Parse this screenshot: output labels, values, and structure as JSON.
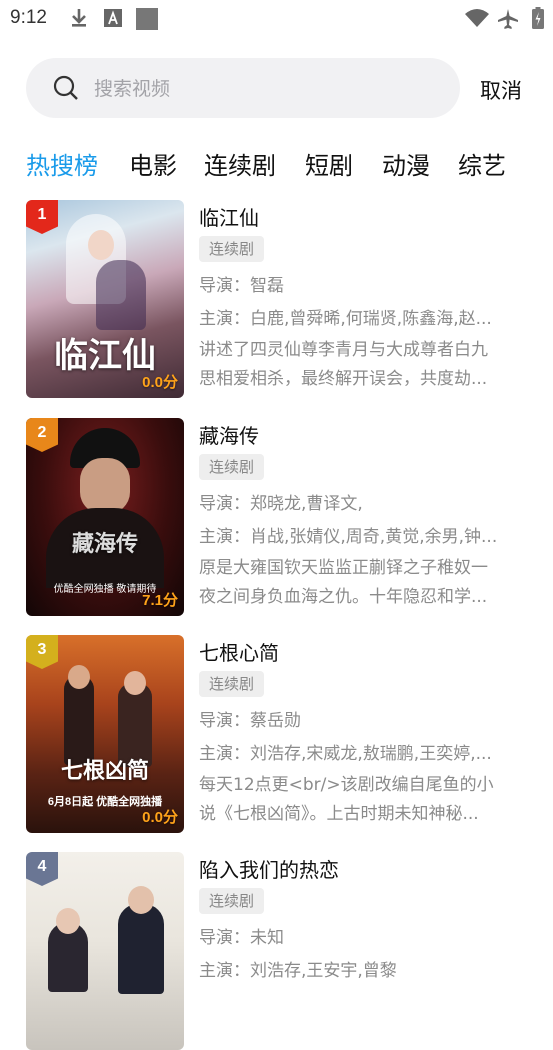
{
  "status_bar": {
    "time": "9:12",
    "left_icons": [
      "download-icon",
      "a-box-icon",
      "square-icon"
    ],
    "right_icons": [
      "wifi-icon",
      "airplane-icon",
      "battery-icon"
    ]
  },
  "search": {
    "placeholder": "搜索视频",
    "value": "",
    "cancel_label": "取消"
  },
  "tabs": [
    {
      "label": "热搜榜",
      "active": true
    },
    {
      "label": "电影",
      "active": false
    },
    {
      "label": "连续剧",
      "active": false
    },
    {
      "label": "短剧",
      "active": false
    },
    {
      "label": "动漫",
      "active": false
    },
    {
      "label": "综艺",
      "active": false
    }
  ],
  "colors": {
    "accent": "#1a9bea",
    "score": "#ffa31a",
    "rank_1": "#e3281b",
    "rank_2": "#e8871a",
    "rank_3": "#d4b01d",
    "rank_other": "#6a7694"
  },
  "items": [
    {
      "rank": "1",
      "title": "临江仙",
      "tag": "连续剧",
      "director": "导演：智磊",
      "cast": "主演：白鹿,曾舜晞,何瑞贤,陈鑫海,赵...",
      "desc1": "讲述了四灵仙尊李青月与大成尊者白九",
      "desc2": "思相爱相杀，最终解开误会，共度劫...",
      "score": "0.0分",
      "poster_text": "临江仙"
    },
    {
      "rank": "2",
      "title": "藏海传",
      "tag": "连续剧",
      "director": "导演：郑晓龙,曹译文,",
      "cast": "主演：肖战,张婧仪,周奇,黄觉,余男,钟...",
      "desc1": "原是大雍国钦天监监正蒯铎之子稚奴一",
      "desc2": "夜之间身负血海之仇。十年隐忍和学...",
      "score": "7.1分",
      "poster_text": "藏海传",
      "poster_note": "优酷全网独播 敬请期待"
    },
    {
      "rank": "3",
      "title": "七根心简",
      "tag": "连续剧",
      "director": "导演：蔡岳勋",
      "cast": "主演：刘浩存,宋威龙,敖瑞鹏,王奕婷,...",
      "desc1": "每天12点更<br/>该剧改编自尾鱼的小",
      "desc2": "说《七根凶简》。上古时期未知神秘...",
      "score": "0.0分",
      "poster_text": "七根凶简",
      "poster_note": "6月8日起 优酷全网独播"
    },
    {
      "rank": "4",
      "title": "陷入我们的热恋",
      "tag": "连续剧",
      "director": "导演：未知",
      "cast": "主演：刘浩存,王安宇,曾黎",
      "desc1": "",
      "desc2": "",
      "score": "",
      "poster_text": ""
    }
  ]
}
